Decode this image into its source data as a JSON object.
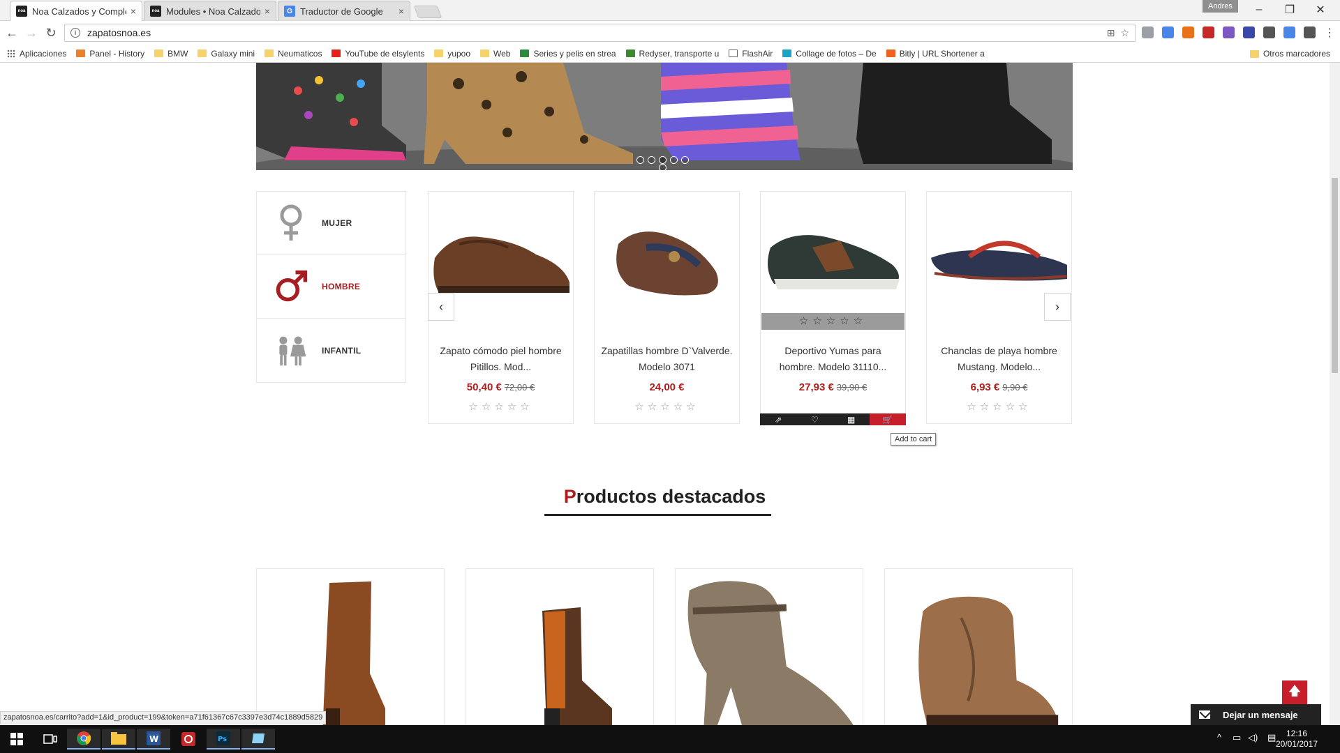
{
  "browser": {
    "tabs": [
      {
        "label": "Noa Calzados y Complem",
        "favicon": "noa",
        "active": true
      },
      {
        "label": "Modules • Noa Calzados",
        "favicon": "noa",
        "active": false
      },
      {
        "label": "Traductor de Google",
        "favicon": "google-translate",
        "active": false
      }
    ],
    "close_glyph": "×",
    "profile_name": "Andres",
    "window_controls": [
      "–",
      "❐",
      "✕"
    ],
    "url": "zapatosnoa.es",
    "info_glyph": "i",
    "bookmarks": [
      {
        "label": "Aplicaciones",
        "icon": "apps",
        "color": "#666666"
      },
      {
        "label": "Panel - History",
        "icon": "diamond",
        "color": "#e8812a"
      },
      {
        "label": "BMW",
        "icon": "folder",
        "color": "#f5d36a"
      },
      {
        "label": "Galaxy mini",
        "icon": "folder",
        "color": "#f5d36a"
      },
      {
        "label": "Neumaticos",
        "icon": "folder",
        "color": "#f5d36a"
      },
      {
        "label": "YouTube de elsylents",
        "icon": "youtube",
        "color": "#e62117"
      },
      {
        "label": "yupoo",
        "icon": "folder",
        "color": "#f5d36a"
      },
      {
        "label": "Web",
        "icon": "folder",
        "color": "#f5d36a"
      },
      {
        "label": "Series y pelis en strea",
        "icon": "series",
        "color": "#2a8c3a"
      },
      {
        "label": "Redyser, transporte u",
        "icon": "redyser",
        "color": "#3c8a2e"
      },
      {
        "label": "FlashAir",
        "icon": "page",
        "color": "#ffffff"
      },
      {
        "label": "Collage de fotos – De",
        "icon": "collage",
        "color": "#1ba3c6"
      },
      {
        "label": "Bitly | URL Shortener a",
        "icon": "bitly",
        "color": "#ee6123"
      }
    ],
    "other_bookmarks": "Otros marcadores",
    "extension_colors": [
      "#9aa0a6",
      "#4a86e8",
      "#e8711a",
      "#c62828",
      "#7e57c2",
      "#3949ab",
      "#555555",
      "#4a86e8",
      "#555555"
    ],
    "status_url": "zapatosnoa.es/carrito?add=1&id_product=199&token=a71f61367c67c3397e3d74c1889d5829"
  },
  "categories": [
    {
      "label": "MUJER",
      "icon": "female-icon",
      "active": false
    },
    {
      "label": "HOMBRE",
      "icon": "male-icon",
      "active": true
    },
    {
      "label": "INFANTIL",
      "icon": "kids-icon",
      "active": false
    }
  ],
  "products": [
    {
      "name": "Zapato cómodo piel hombre Pitillos. Mod...",
      "price": "50,40 €",
      "old_price": "72,00 €",
      "stars": "☆☆☆☆☆",
      "hovered": false
    },
    {
      "name": "Zapatillas hombre D`Valverde. Modelo 3071",
      "price": "24,00 €",
      "old_price": "",
      "stars": "☆☆☆☆☆",
      "hovered": false
    },
    {
      "name": "Deportivo Yumas para hombre. Modelo 31110...",
      "price": "27,93 €",
      "old_price": "39,90 €",
      "stars": "☆☆☆☆☆",
      "hovered": true
    },
    {
      "name": "Chanclas de playa hombre Mustang. Modelo...",
      "price": "6,93 €",
      "old_price": "9,90 €",
      "stars": "☆☆☆☆☆",
      "hovered": false
    }
  ],
  "carousel": {
    "prev": "‹",
    "next": "›",
    "slides": 5,
    "active_slide": 2
  },
  "tooltip": "Add to cart",
  "featured": {
    "title_first": "P",
    "title_rest": "roductos destacados"
  },
  "chat": {
    "label": "Dejar un mensaje"
  },
  "back_to_top_glyph": "🡅",
  "taskbar": {
    "time": "12:16",
    "date": "20/01/2017"
  },
  "colors": {
    "accent": "#b01c1c",
    "cart_red": "#c61e2a"
  }
}
